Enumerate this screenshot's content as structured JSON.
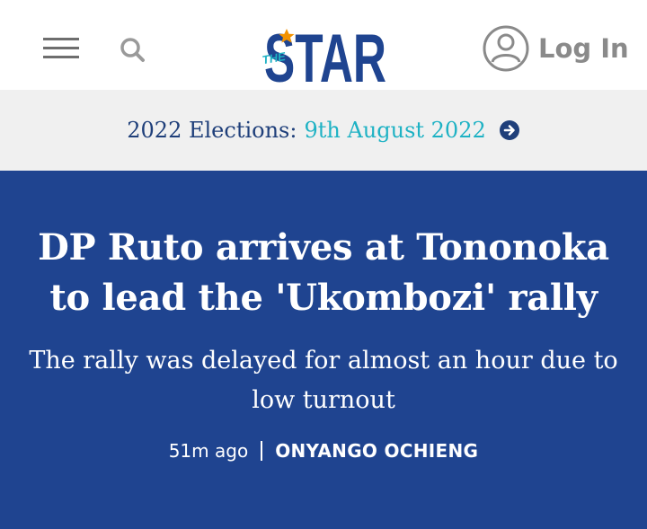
{
  "header": {
    "logo": {
      "the": "THE",
      "star": "STAR"
    },
    "login_label": "Log In",
    "icons": {
      "menu": "hamburger-menu-icon",
      "search": "search-icon",
      "user": "user-avatar-icon"
    }
  },
  "election_banner": {
    "label": "2022 Elections:",
    "date": "9th August 2022",
    "icon": "arrow-right-circle-icon"
  },
  "article": {
    "headline": "DP Ruto arrives at Tononoka to lead the 'Ukombozi' rally",
    "subheadline": "The rally was delayed for almost an hour due to low turnout",
    "time_ago": "51m ago",
    "author": "ONYANGO OCHIENG"
  },
  "colors": {
    "brand_navy": "#1f4490",
    "accent_teal": "#1eb2c4",
    "accent_orange": "#f39200",
    "banner_bg": "#f0f0f0"
  }
}
